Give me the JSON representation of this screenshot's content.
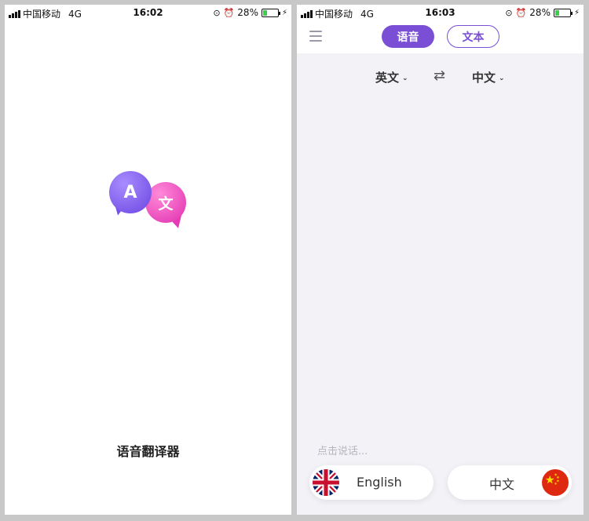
{
  "status_left": {
    "carrier": "中国移动",
    "network": "4G",
    "time": "16:02",
    "battery": "28%",
    "battery_level": 0.28
  },
  "status_right": {
    "carrier": "中国移动",
    "network": "4G",
    "time": "16:03",
    "battery": "28%",
    "battery_level": 0.28
  },
  "splash": {
    "logo_left_letter": "A",
    "logo_right_letter": "文",
    "app_name": "语音翻译器"
  },
  "translator": {
    "tabs": [
      {
        "label": "语音",
        "active": true
      },
      {
        "label": "文本",
        "active": false
      }
    ],
    "source_language": "英文",
    "target_language": "中文",
    "prompt": "点击说话...",
    "buttons": [
      {
        "label": "English",
        "flag": "uk-flag-icon"
      },
      {
        "label": "中文",
        "flag": "china-flag-icon"
      }
    ]
  },
  "colors": {
    "accent": "#7a4fd6",
    "battery_green": "#3bcd4c",
    "bubble_purple": "#6b45e0",
    "bubble_pink": "#e02faf"
  }
}
